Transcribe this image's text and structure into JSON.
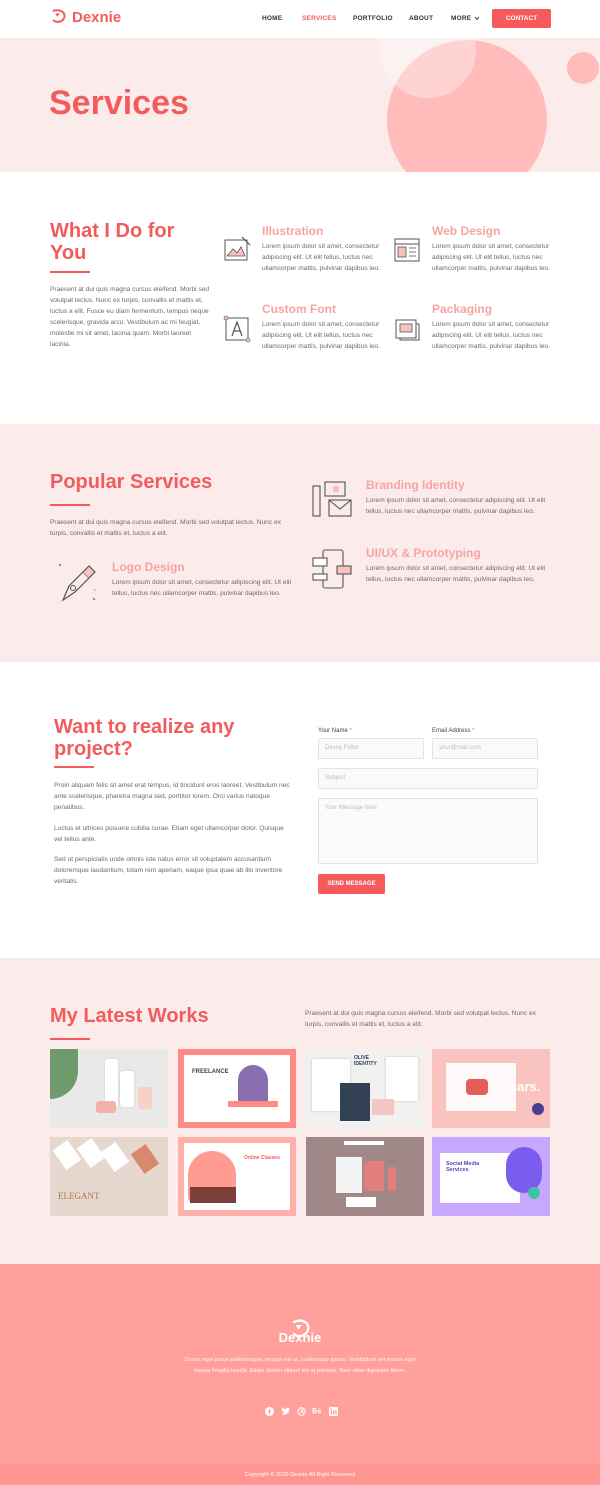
{
  "brand": {
    "name": "Dexnie",
    "accent": "#f25c5c",
    "button": "#f65a5a",
    "soft_bg": "#fbeceb",
    "footer_bg": "#ffa09c"
  },
  "nav": {
    "items": [
      {
        "label": "HOME"
      },
      {
        "label": "SERVICES"
      },
      {
        "label": "PORTFOLIO"
      },
      {
        "label": "ABOUT"
      },
      {
        "label": "MORE"
      }
    ],
    "contact_label": "CONTACT"
  },
  "hero": {
    "title": "Services"
  },
  "what": {
    "title": "What I Do for You",
    "description": "Praesent at dui quis magna cursus eleifend. Morbi sed volutpat lectus. Nunc ex turpis, convallis et mattis et, luctus a elit. Fusce eu diam fermentum, tempus neque scelerisque, gravida arcu. Vestibulum ac mi feugiat, molestie mi sit amet, lacinia quam. Morbi laoreet lacinia.",
    "services": [
      {
        "title": "Illustration",
        "icon": "illustration-icon",
        "text": "Lorem ipsum dolor sit amet, consectetur adipiscing elit. Ut elit tellus, luctus nec ullamcorper mattis, pulvinar dapibus leo."
      },
      {
        "title": "Web Design",
        "icon": "web-design-icon",
        "text": "Lorem ipsum dolor sit amet, consectetur adipiscing elit. Ut elit tellus, luctus nec ullamcorper mattis, pulvinar dapibus leo."
      },
      {
        "title": "Custom Font",
        "icon": "custom-font-icon",
        "text": "Lorem ipsum dolor sit amet, consectetur adipiscing elit. Ut elit tellus, luctus nec ullamcorper mattis, pulvinar dapibus leo."
      },
      {
        "title": "Packaging",
        "icon": "packaging-icon",
        "text": "Lorem ipsum dolor sit amet, consectetur adipiscing elit. Ut elit tellus, luctus nec ullamcorper mattis, pulvinar dapibus leo."
      }
    ]
  },
  "popular": {
    "title": "Popular Services",
    "description": "Praesent at dui quis magna cursus eleifend. Morbi sed volutpat lectus. Nunc ex turpis, convallis et mattis et, luctus a elit.",
    "services": [
      {
        "title": "Logo Design",
        "icon": "pen-tool-icon",
        "text": "Lorem ipsum dolor sit amet, consectetur adipiscing elit. Ut elit tellus, luctus nec ullamcorper mattis, pulvinar dapibus leo."
      },
      {
        "title": "Branding Identity",
        "icon": "branding-icon",
        "text": "Lorem ipsum dolor sit amet, consectetur adipiscing elit. Ut elit tellus, luctus nec ullamcorper mattis, pulvinar dapibus leo."
      },
      {
        "title": "UI/UX & Prototyping",
        "icon": "prototyping-icon",
        "text": "Lorem ipsum dolor sit amet, consectetur adipiscing elit. Ut elit tellus, luctus nec ullamcorper mattis, pulvinar dapibus leo."
      }
    ]
  },
  "contact": {
    "title": "Want to realize any project?",
    "paragraphs": [
      "Proin aliquam felis sit amet erat tempus, id tincidunt eros laoreet. Vestibulum nec ante scelerisque, pharetra magna sed, porttitor lorem. Orci varius natoque penatibus.",
      "Luctus et ultrices posuere cubilia curae. Etiam eget ullamcorper dolor. Quisque vel tellus ante.",
      "Sed ut perspiciatis unde omnis iste natus error sit voluptatem accusantium doloremque laudantium, totam rem aperiam, eaque ipsa quae ab illo inventore veritatis."
    ],
    "form": {
      "name_label": "Your Name",
      "email_label": "Email Address",
      "required_mark": "*",
      "name_placeholder": "Dexny Folter",
      "email_placeholder": "your@mail.com",
      "subject_placeholder": "Subject",
      "message_placeholder": "Your Message here",
      "send_label": "SEND MESSAGE"
    }
  },
  "works": {
    "title": "My Latest Works",
    "description": "Praesent at dui quis magna cursus eleifend. Morbi sed volutpat lectus. Nunc ex turpis, convallis et mattis et, luctus a elit.",
    "items": [
      {
        "name": "cosmetic-packaging",
        "bg": "#e9e9e9"
      },
      {
        "name": "freelance-landing",
        "bg": "#ff8b86",
        "caption": "FREELANCE"
      },
      {
        "name": "olive-identity",
        "bg": "#f1f1f1",
        "caption": "OLIVE IDENTITY"
      },
      {
        "name": "cars-landing",
        "bg": "#f9c3c0",
        "caption": "cars."
      },
      {
        "name": "elegant-cards",
        "bg": "#e6d8cf",
        "caption": "ELEGANT"
      },
      {
        "name": "online-classes",
        "bg": "#ffb0a8",
        "caption": "Online Classes"
      },
      {
        "name": "stationery-mockup",
        "bg": "#a08888"
      },
      {
        "name": "social-media-services",
        "bg": "#c8a8ff",
        "caption": "Social Media Services"
      }
    ]
  },
  "footer": {
    "name": "Dexnie",
    "text": "Donec eget purus pellentesque, tempor est ut, scelerisque ipsum. Vestibulum vel massa eget massa fringilla iaculis. Etiam dictum aliquet leo at pulvinar. Nam vitae dignissim libero.",
    "socials": [
      "facebook-icon",
      "twitter-icon",
      "dribbble-icon",
      "behance-icon",
      "linkedin-icon"
    ],
    "copyright": "Copyright © 2020 Dexnie All Right Reserved"
  }
}
